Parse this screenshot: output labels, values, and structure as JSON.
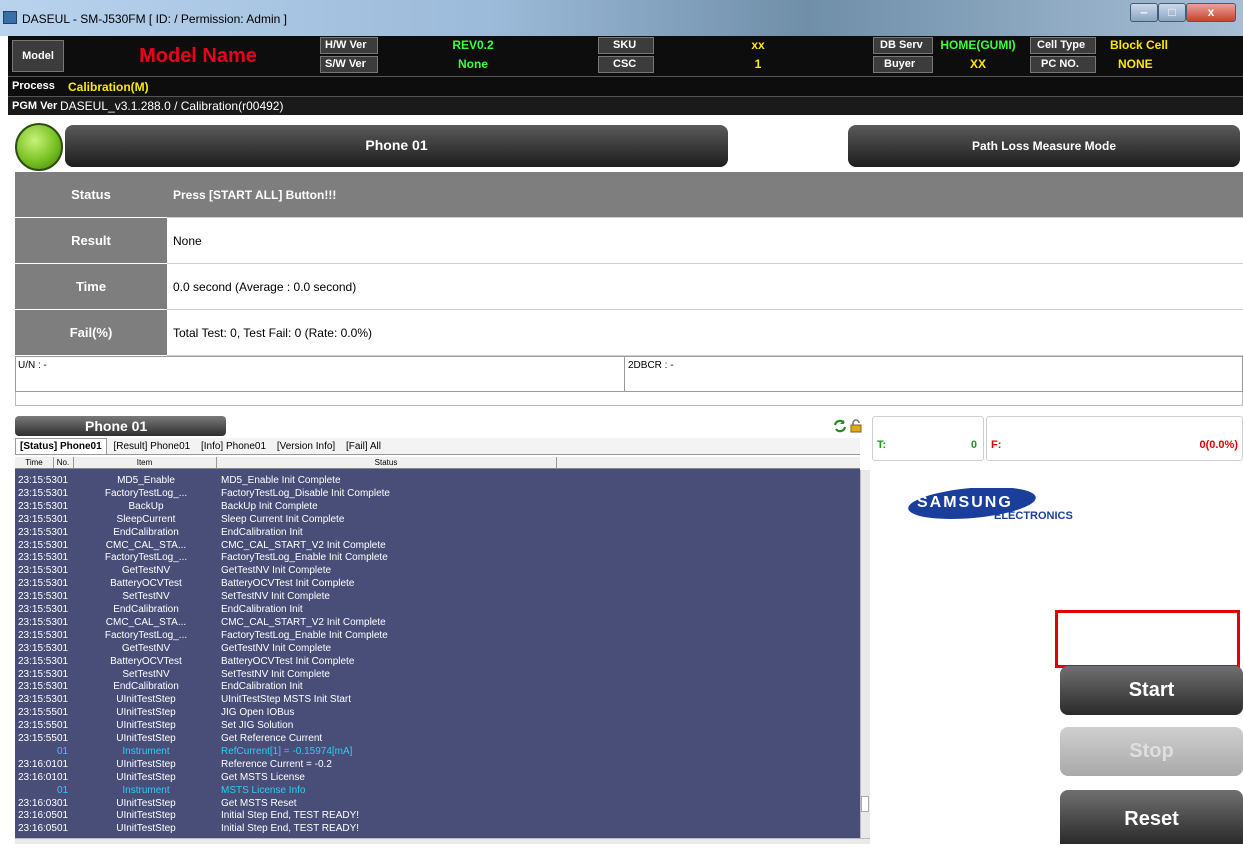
{
  "window": {
    "title": "DASEUL - SM-J530FM [ ID:  / Permission: Admin ]",
    "min_glyph": "‒",
    "max_glyph": "□",
    "close_glyph": "x"
  },
  "header": {
    "model_label": "Model",
    "model_name": "Model Name",
    "hw_label": "H/W Ver",
    "hw_value": "REV0.2",
    "sw_label": "S/W Ver",
    "sw_value": "None",
    "sku_label": "SKU",
    "sku_value": "xx",
    "csc_label": "CSC",
    "csc_value": "1",
    "dbserv_label": "DB Serv",
    "dbserv_value": "HOME(GUMI)",
    "buyer_label": "Buyer",
    "buyer_value": "XX",
    "celltype_label": "Cell Type",
    "celltype_value": "Block Cell",
    "pcno_label": "PC NO.",
    "pcno_value": "NONE",
    "process_label": "Process",
    "process_value": "Calibration(M)",
    "pgm_label": "PGM Ver",
    "pgm_value": "DASEUL_v3.1.288.0 / Calibration(r00492)"
  },
  "phone": {
    "title": "Phone 01",
    "mode_button": "Path Loss Measure Mode"
  },
  "status_table": {
    "status_label": "Status",
    "status_value": "Press [START ALL] Button!!!",
    "result_label": "Result",
    "result_value": "None",
    "time_label": "Time",
    "time_value": "0.0 second (Average : 0.0 second)",
    "fail_label": "Fail(%)",
    "fail_value": "Total Test: 0, Test Fail: 0 (Rate: 0.0%)"
  },
  "info": {
    "un": "U/N : -",
    "dbcr": "2DBCR : -"
  },
  "log": {
    "phone_tab": "Phone 01",
    "tabs": [
      "[Status] Phone01",
      "[Result] Phone01",
      "[Info] Phone01",
      "[Version Info]",
      "[Fail] All"
    ],
    "columns": [
      "Time",
      "No.",
      "Item",
      "Status"
    ],
    "rows": [
      {
        "time": "23:15:53",
        "no": "01",
        "item": "MD5_Enable",
        "status": "MD5_Enable Init Complete"
      },
      {
        "time": "23:15:53",
        "no": "01",
        "item": "FactoryTestLog_...",
        "status": "FactoryTestLog_Disable Init Complete"
      },
      {
        "time": "23:15:53",
        "no": "01",
        "item": "BackUp",
        "status": "BackUp Init Complete"
      },
      {
        "time": "23:15:53",
        "no": "01",
        "item": "SleepCurrent",
        "status": "Sleep Current Init Complete"
      },
      {
        "time": "23:15:53",
        "no": "01",
        "item": "EndCalibration",
        "status": "EndCalibration Init"
      },
      {
        "time": "23:15:53",
        "no": "01",
        "item": "CMC_CAL_STA...",
        "status": "CMC_CAL_START_V2 Init Complete"
      },
      {
        "time": "23:15:53",
        "no": "01",
        "item": "FactoryTestLog_...",
        "status": "FactoryTestLog_Enable Init Complete"
      },
      {
        "time": "23:15:53",
        "no": "01",
        "item": "GetTestNV",
        "status": "GetTestNV Init Complete"
      },
      {
        "time": "23:15:53",
        "no": "01",
        "item": "BatteryOCVTest",
        "status": "BatteryOCVTest Init Complete"
      },
      {
        "time": "23:15:53",
        "no": "01",
        "item": "SetTestNV",
        "status": "SetTestNV Init Complete"
      },
      {
        "time": "23:15:53",
        "no": "01",
        "item": "EndCalibration",
        "status": "EndCalibration Init"
      },
      {
        "time": "23:15:53",
        "no": "01",
        "item": "CMC_CAL_STA...",
        "status": "CMC_CAL_START_V2 Init Complete"
      },
      {
        "time": "23:15:53",
        "no": "01",
        "item": "FactoryTestLog_...",
        "status": "FactoryTestLog_Enable Init Complete"
      },
      {
        "time": "23:15:53",
        "no": "01",
        "item": "GetTestNV",
        "status": "GetTestNV Init Complete"
      },
      {
        "time": "23:15:53",
        "no": "01",
        "item": "BatteryOCVTest",
        "status": "BatteryOCVTest Init Complete"
      },
      {
        "time": "23:15:53",
        "no": "01",
        "item": "SetTestNV",
        "status": "SetTestNV Init Complete"
      },
      {
        "time": "23:15:53",
        "no": "01",
        "item": "EndCalibration",
        "status": "EndCalibration Init"
      },
      {
        "time": "23:15:53",
        "no": "01",
        "item": "UInitTestStep",
        "status": "UInitTestStep MSTS Init Start"
      },
      {
        "time": "23:15:55",
        "no": "01",
        "item": "UInitTestStep",
        "status": "JIG Open IOBus"
      },
      {
        "time": "23:15:55",
        "no": "01",
        "item": "UInitTestStep",
        "status": "Set JIG Solution"
      },
      {
        "time": "23:15:55",
        "no": "01",
        "item": "UInitTestStep",
        "status": "Get Reference Current"
      },
      {
        "time": "",
        "no": "01",
        "item": "Instrument",
        "status": "RefCurrent[1] = -0.15974[mA]",
        "instrument": true
      },
      {
        "time": "23:16:01",
        "no": "01",
        "item": "UInitTestStep",
        "status": "Reference Current = -0.2"
      },
      {
        "time": "23:16:01",
        "no": "01",
        "item": "UInitTestStep",
        "status": "Get MSTS License"
      },
      {
        "time": "",
        "no": "01",
        "item": "Instrument",
        "status": "MSTS License Info",
        "instrument": true
      },
      {
        "time": "23:16:03",
        "no": "01",
        "item": "UInitTestStep",
        "status": "Get MSTS Reset"
      },
      {
        "time": "23:16:05",
        "no": "01",
        "item": "UInitTestStep",
        "status": "Initial Step End, TEST READY!"
      },
      {
        "time": "23:16:05",
        "no": "01",
        "item": "UInitTestStep",
        "status": "Initial Step End, TEST READY!"
      }
    ]
  },
  "counter": {
    "t_label": "T:",
    "t_value": "0",
    "f_label": "F:",
    "f_value": "0(0.0%)"
  },
  "logo": {
    "brand": "SAMSUNG",
    "sub": "ELECTRONICS"
  },
  "buttons": {
    "start": "Start",
    "stop": "Stop",
    "reset": "Reset"
  },
  "colors": {
    "model_name": "#e8001c",
    "header_value": "#ffe600",
    "green_value": "#3dff3d",
    "log_bg": "#484e78",
    "instrument_text": "#33c9f5",
    "highlight_box": "#e00000"
  }
}
